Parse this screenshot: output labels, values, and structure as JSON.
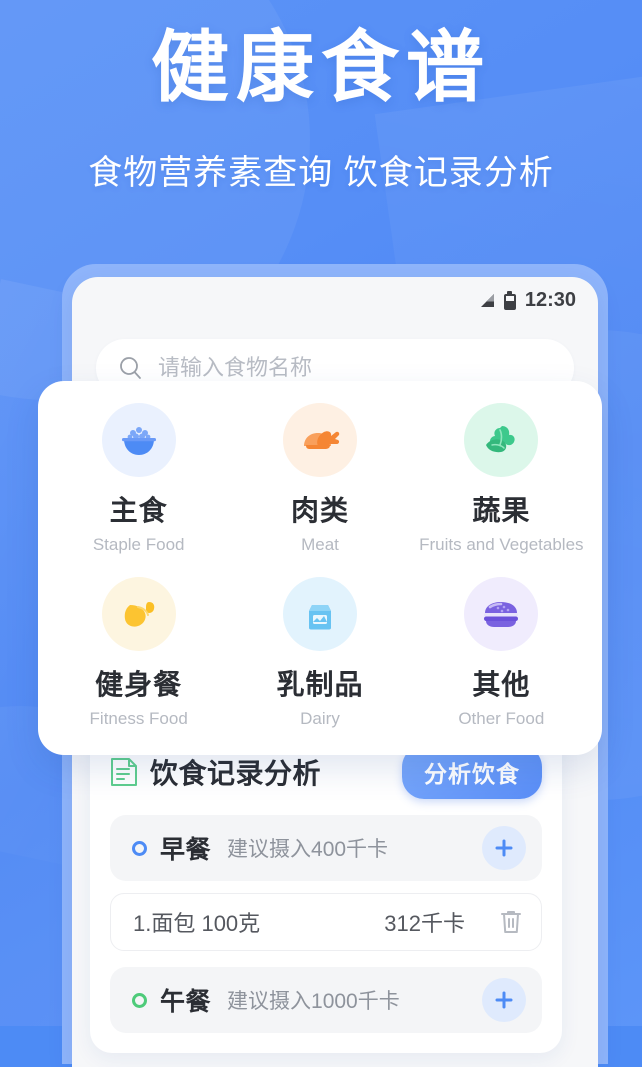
{
  "header": {
    "title": "健康食谱",
    "subtitle": "食物营养素查询 饮食记录分析"
  },
  "status_bar": {
    "time": "12:30",
    "signal_icon": "signal-bars-icon",
    "battery_icon": "battery-icon"
  },
  "search": {
    "placeholder": "请输入食物名称",
    "value": "",
    "icon": "search-icon"
  },
  "categories": [
    {
      "cn": "主食",
      "en": "Staple Food",
      "icon": "rice-bowl-icon",
      "circle_color": "#eaf1fe",
      "accent": "#4d8bf5"
    },
    {
      "cn": "肉类",
      "en": "Meat",
      "icon": "chicken-icon",
      "circle_color": "#fef0e3",
      "accent": "#f79344"
    },
    {
      "cn": "蔬果",
      "en": "Fruits and Vegetables",
      "icon": "vegetable-icon",
      "circle_color": "#dcf7ea",
      "accent": "#34c281"
    },
    {
      "cn": "健身餐",
      "en": "Fitness Food",
      "icon": "flexed-arm-icon",
      "circle_color": "#fdf5e0",
      "accent": "#fbc02d"
    },
    {
      "cn": "乳制品",
      "en": "Dairy",
      "icon": "milk-carton-icon",
      "circle_color": "#e2f3fd",
      "accent": "#61bdf0"
    },
    {
      "cn": "其他",
      "en": "Other Food",
      "icon": "burger-icon",
      "circle_color": "#f0ecfd",
      "accent": "#7a62e0"
    }
  ],
  "diet": {
    "section_title": "饮食记录分析",
    "section_icon": "document-list-icon",
    "analyze_label": "分析饮食",
    "rows": [
      {
        "type": "meal",
        "dot_color": "#4d8bf5",
        "name": "早餐",
        "advice": "建议摄入400千卡",
        "add_icon": "plus-icon"
      },
      {
        "type": "food",
        "name": "1.面包  100克",
        "kcal": "312千卡",
        "delete_icon": "trash-icon"
      },
      {
        "type": "meal",
        "dot_color": "#4ecb7a",
        "name": "午餐",
        "advice": "建议摄入1000千卡",
        "add_icon": "plus-icon"
      }
    ]
  },
  "theme": {
    "background_blue": "#4d8bf5",
    "phone_frame_blue": "#8fb5fb",
    "accent_blue": "#4d8bf5",
    "accent_green": "#4ecb7a"
  }
}
